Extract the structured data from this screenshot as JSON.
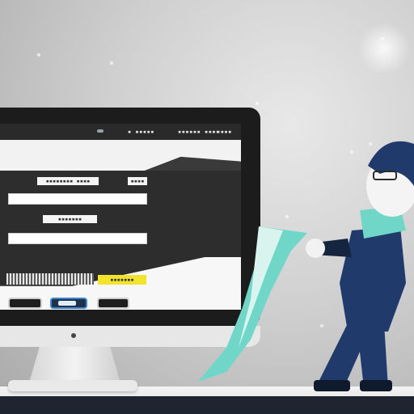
{
  "screen": {
    "topbar": {
      "tabs": [
        "▪ ▪▪▪▪▪",
        "▪▪▪▪▪▪ ▪▪▪▪",
        "▪▪▪▪"
      ]
    },
    "form": {
      "field1_label": "▪▪▪▪▪▪▪▪ ▪▪▪▪",
      "field1_label_b": "▪▪▪▪",
      "field2_label": "▪▪▪▪▪▪▪",
      "progress_label": "▪▪▪▪▪▪▪"
    }
  },
  "colors": {
    "accent_blue": "#3f86d4",
    "highlight_yellow": "#f3e32c",
    "character_teal": "#6fd6c8",
    "character_navy": "#1f3a6b"
  }
}
